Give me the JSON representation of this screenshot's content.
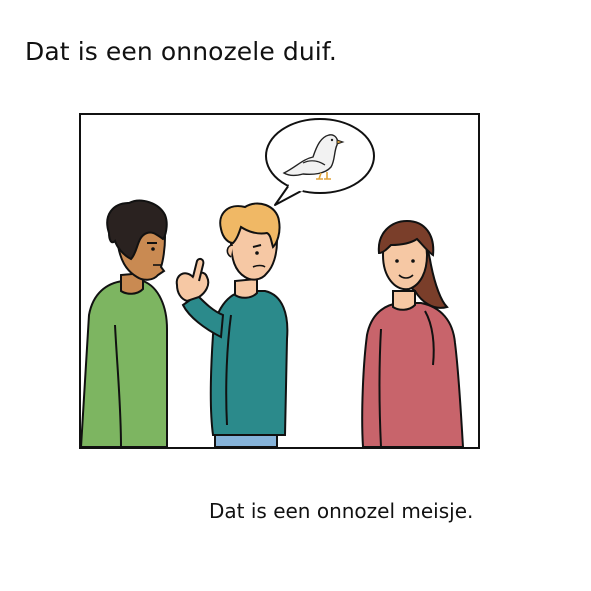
{
  "illustration": {
    "top_sentence": "Dat is een onnozele duif.",
    "bottom_sentence": "Dat is een onnozel meisje."
  },
  "icons": {
    "speech_bubble": "dove-speech-bubble-icon"
  },
  "colors": {
    "shirt_left": "#7db561",
    "shirt_middle": "#2b8a8b",
    "shirt_right": "#c8646b",
    "skin_dark": "#c98a52",
    "skin_light": "#f6c8a4",
    "hair_dark": "#2a2220",
    "hair_blond": "#f0b865",
    "hair_brown": "#7a3e2a",
    "jeans": "#86b3d9"
  }
}
